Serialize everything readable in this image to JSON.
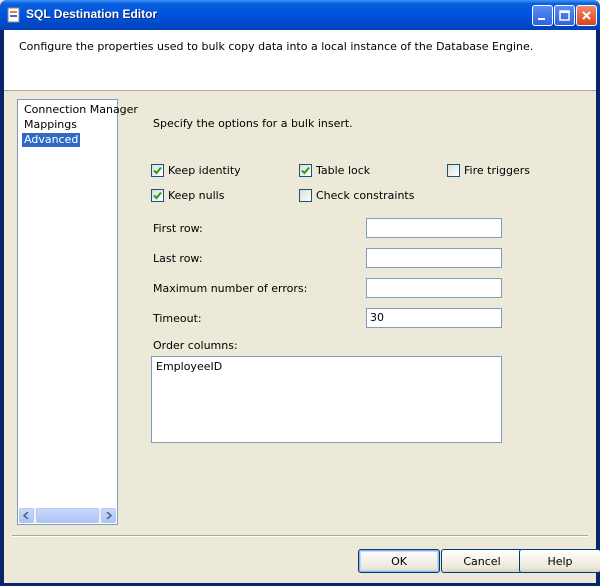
{
  "window": {
    "title": "SQL Destination Editor"
  },
  "header": {
    "description": "Configure the properties used to bulk copy data into a local instance of the Database Engine."
  },
  "nav": {
    "items": [
      {
        "label": "Connection Manager"
      },
      {
        "label": "Mappings"
      },
      {
        "label": "Advanced"
      }
    ],
    "selected": "Advanced"
  },
  "advanced": {
    "intro": "Specify the options for a bulk insert.",
    "options": {
      "keep_identity": {
        "label": "Keep identity",
        "checked": true
      },
      "table_lock": {
        "label": "Table lock",
        "checked": true
      },
      "fire_triggers": {
        "label": "Fire triggers",
        "checked": false
      },
      "keep_nulls": {
        "label": "Keep nulls",
        "checked": true
      },
      "check_constraints": {
        "label": "Check constraints",
        "checked": false
      }
    },
    "first_row": {
      "label": "First row:",
      "value": ""
    },
    "last_row": {
      "label": "Last row:",
      "value": ""
    },
    "max_errors": {
      "label": "Maximum number of errors:",
      "value": ""
    },
    "timeout": {
      "label": "Timeout:",
      "value": "30"
    },
    "order_columns": {
      "label": "Order columns:",
      "value": "EmployeeID"
    }
  },
  "buttons": {
    "ok": "OK",
    "cancel": "Cancel",
    "help": "Help"
  },
  "colors": {
    "titlebar": "#0055e5",
    "selection": "#316ac5",
    "dialog_bg": "#ece9d8",
    "check": "#21a121"
  }
}
